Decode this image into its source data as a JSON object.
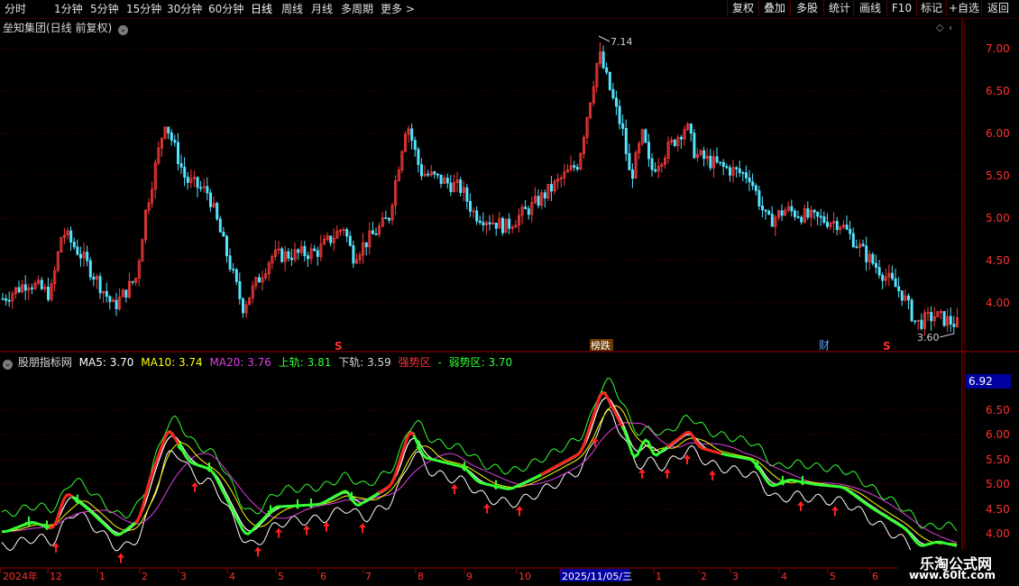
{
  "toolbar": {
    "periods": [
      "分时",
      "1分钟",
      "5分钟",
      "15分钟",
      "30分钟",
      "60分钟",
      "日线",
      "周线",
      "月线",
      "多周期",
      "更多 >"
    ],
    "active_period": "日线",
    "buttons": [
      "复权",
      "叠加",
      "多股",
      "统计",
      "画线",
      "F10",
      "标记",
      "+自选",
      "返回"
    ]
  },
  "main_chart": {
    "title": "垒知集团(日线 前复权)",
    "price_ticks": [
      "7.00",
      "6.50",
      "6.00",
      "5.50",
      "5.00",
      "4.50",
      "4.00"
    ],
    "high_label": "7.14",
    "low_label": "3.60",
    "markers": [
      {
        "text": "S",
        "color": "#ff3030"
      },
      {
        "text": "榜跌",
        "color": "#ffffff"
      },
      {
        "text": "财",
        "color": "#5aa0ff"
      },
      {
        "text": "S",
        "color": "#ff3030"
      }
    ]
  },
  "indicator": {
    "name": "股朋指标网",
    "ma5": "MA5: 3.70",
    "ma10": "MA10: 3.74",
    "ma20": "MA20: 3.76",
    "upper": "上轨: 3.81",
    "lower": "下轨: 3.59",
    "strong": "强势区",
    "dash": "-",
    "weak": "弱势区: 3.70",
    "current_value": "6.92",
    "ticks": [
      "6.50",
      "6.00",
      "5.50",
      "5.00",
      "4.50",
      "4.00"
    ],
    "colors": {
      "ma5": "#ffffff",
      "ma10": "#ffff00",
      "ma20": "#e040e0",
      "upper": "#33ff33",
      "strong": "#ff3030",
      "weak": "#33ff33"
    }
  },
  "date_axis": {
    "labels": [
      "2024年",
      "12",
      "1",
      "2",
      "3",
      "4",
      "5",
      "6",
      "7",
      "8",
      "9",
      "10",
      "2025/11/05/三",
      "1",
      "2",
      "3",
      "4",
      "5",
      "6"
    ]
  },
  "watermark": {
    "line1": "乐淘公式网",
    "line2": "www.60lt.com"
  }
}
